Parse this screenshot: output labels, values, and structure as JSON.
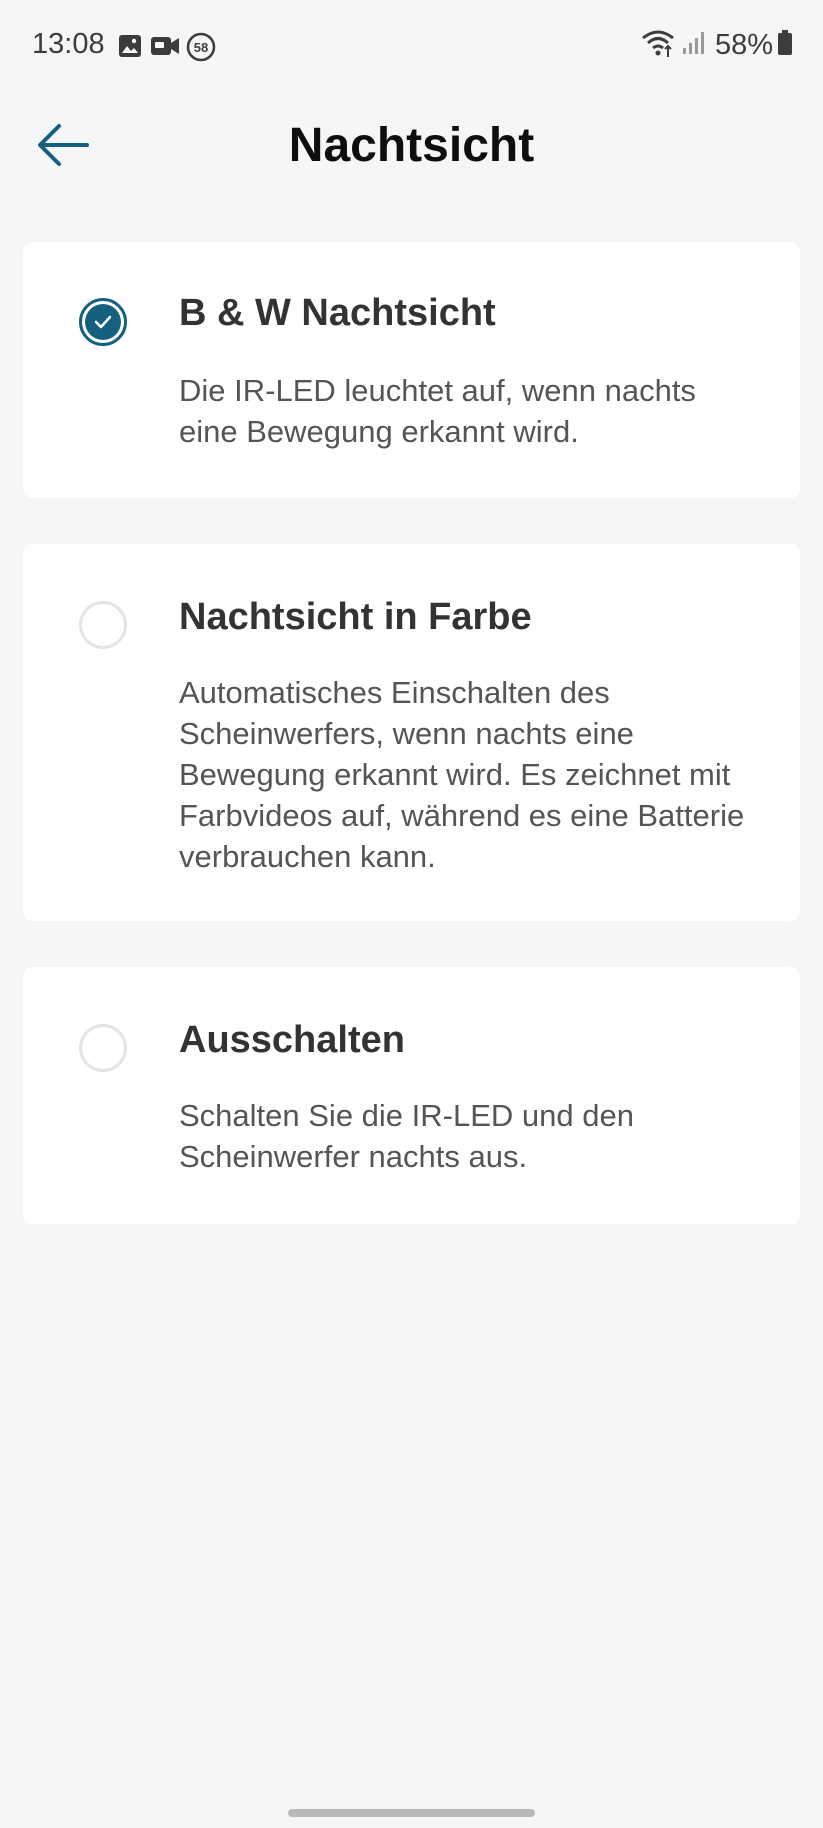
{
  "status_bar": {
    "time": "13:08",
    "notification_icons": [
      "gallery-icon",
      "video-badge-icon",
      "badge-58-icon"
    ],
    "badge_number": "58",
    "battery": "58%"
  },
  "header": {
    "title": "Nachtsicht",
    "back_icon": "arrow-left-icon"
  },
  "options": [
    {
      "title": "B & W Nachtsicht",
      "description": "Die IR-LED leuchtet auf, wenn nachts eine Bewegung erkannt wird.",
      "selected": true
    },
    {
      "title": "Nachtsicht in Farbe",
      "description": "Automatisches Einschalten des Scheinwerfers, wenn nachts eine Bewegung erkannt wird. Es zeichnet mit Farbvideos auf, während es eine Batterie verbrauchen kann.",
      "selected": false
    },
    {
      "title": "Ausschalten",
      "description": "Schalten Sie die IR-LED und den Scheinwerfer nachts aus.",
      "selected": false
    }
  ],
  "colors": {
    "accent": "#16607f",
    "background": "#f5f6f8",
    "card": "#ffffff"
  }
}
